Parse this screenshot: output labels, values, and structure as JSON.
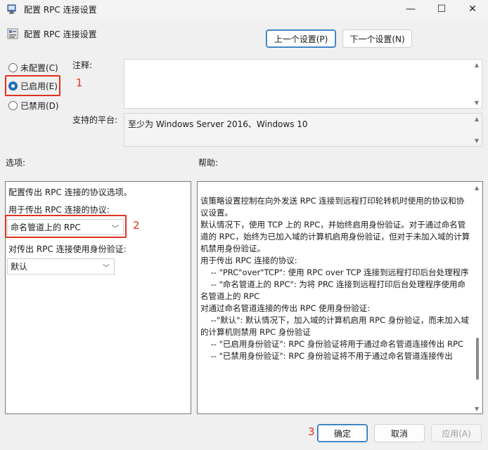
{
  "window": {
    "title": "配置 RPC 连接设置",
    "minimize": "—",
    "maximize": "☐",
    "close": "✕"
  },
  "header": {
    "title": "配置 RPC 连接设置"
  },
  "nav": {
    "prev": "上一个设置(P)",
    "next": "下一个设置(N)"
  },
  "state": {
    "not_configured": "未配置(C)",
    "enabled": "已启用(E)",
    "disabled": "已禁用(D)",
    "selected": "enabled"
  },
  "fields": {
    "comment_label": "注释:",
    "comment_value": "",
    "platform_label": "支持的平台:",
    "platform_value": "至少为 Windows Server 2016、Windows 10"
  },
  "sections": {
    "options": "选项:",
    "help": "帮助:"
  },
  "options": {
    "description": "配置传出 RPC 连接的协议选项。",
    "protocol_label": "用于传出 RPC 连接的协议:",
    "protocol_value": "命名管道上的 RPC",
    "auth_label": "对传出 RPC 连接使用身份验证:",
    "auth_value": "默认"
  },
  "help": {
    "lines": [
      "该策略设置控制在向外发送 RPC 连接到远程打印轮转机时使用的协议和协议设置。",
      "",
      "默认情况下，使用 TCP 上的 RPC，并始终启用身份验证。对于通过命名管道的 RPC，始终为已加入域的计算机启用身份验证，但对于未加入域的计算机禁用身份验证。",
      "",
      "用于传出 RPC 连接的协议:",
      "    -- \"PRC\"over\"TCP\": 使用 RPC over TCP 连接到远程打印后台处理程序",
      "    -- \"命名管道上的 RPC\": 为将 PRC 连接到远程打印后台处理程序使用命名管道上的 RPC",
      "",
      "对通过命名管道连接的传出 RPC 使用身份验证:",
      "    --\"默认\": 默认情况下，加入域的计算机启用 RPC 身份验证，而未加入域的计算机则禁用 RPC 身份验证",
      "    -- \"已启用身份验证\": RPC 身份验证将用于通过命名管道连接传出 RPC",
      "    -- \"已禁用身份验证\": RPC 身份验证将不用于通过命名管道连接传出"
    ]
  },
  "footer": {
    "ok": "确定",
    "cancel": "取消",
    "apply": "应用(A)"
  },
  "annotations": {
    "a1": "1",
    "a2": "2",
    "a3": "3"
  },
  "colors": {
    "accent": "#1f6fb8",
    "annotation": "#e0301e"
  }
}
